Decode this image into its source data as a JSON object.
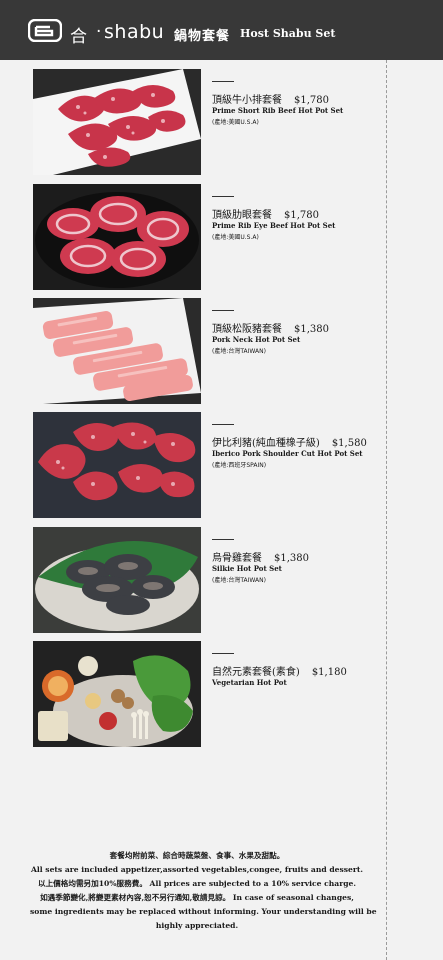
{
  "header": {
    "brand_he": "合",
    "brand_dot": "·",
    "brand_name": "shabu",
    "title": "鍋物套餐",
    "subtitle": "Host Shabu Set",
    "bg_color": "#383838"
  },
  "items": [
    {
      "zh": "頂級牛小排套餐",
      "price": "$1,780",
      "en": "Prime Short Rib Beef Hot Pot Set",
      "origin": "(產地:美國U.S.A)",
      "image": "marbled-short-rib-beef-slices"
    },
    {
      "zh": "頂級肋眼套餐",
      "price": "$1,780",
      "en": "Prime Rib Eye Beef Hot Pot Set",
      "origin": "(產地:美國U.S.A)",
      "image": "rolled-rib-eye-slices-on-black-plate"
    },
    {
      "zh": "頂級松阪豬套餐",
      "price": "$1,380",
      "en": "Pork Neck Hot Pot Set",
      "origin": "(產地:台灣TAIWAN)",
      "image": "pink-pork-neck-slices"
    },
    {
      "zh": "伊比利豬(純血種橡子級)",
      "price": "$1,580",
      "en": "Iberico Pork Shoulder Cut Hot Pot Set",
      "origin": "(產地:西班牙SPAIN)",
      "image": "iberico-pork-slices-on-dark-tray"
    },
    {
      "zh": "烏骨雞套餐",
      "price": "$1,380",
      "en": "Silkie Hot Pot Set",
      "origin": "(產地:台灣TAIWAN)",
      "image": "silkie-chicken-on-leaf"
    },
    {
      "zh": "自然元素套餐(素食)",
      "price": "$1,180",
      "en": "Vegetarian Hot Pot",
      "origin": "",
      "image": "vegetable-platter"
    }
  ],
  "footer": {
    "lines": [
      "套餐均附前菜、綜合時蔬菜盤、食事、水果及甜點。",
      "All sets are included appetizer,assorted vegetables,congee, fruits and dessert.",
      "以上價格均需另加10%服務費。 All prices are subjected to a 10% service charge.",
      "如遇季節變化,將變更素材內容,恕不另行通知,敬請見諒。 In case of seasonal changes,",
      "some ingredients may be replaced without informing. Your understanding will be",
      "highly appreciated."
    ]
  }
}
